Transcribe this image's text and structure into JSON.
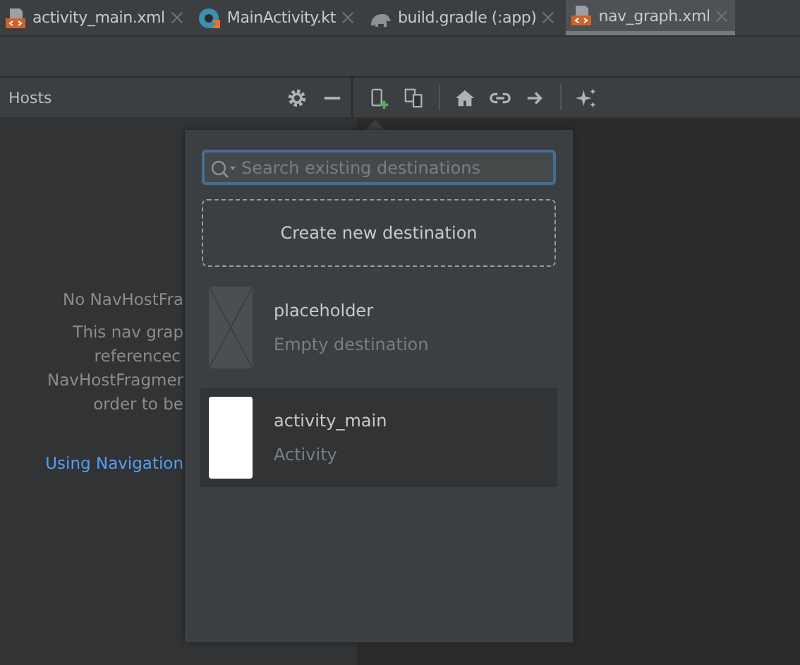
{
  "tabs": [
    {
      "label": "activity_main.xml",
      "kind": "xml",
      "selected": false
    },
    {
      "label": "MainActivity.kt",
      "kind": "kotlin",
      "selected": false
    },
    {
      "label": "build.gradle (:app)",
      "kind": "gradle",
      "selected": false
    },
    {
      "label": "nav_graph.xml",
      "kind": "xml",
      "selected": true
    }
  ],
  "hosts_panel": {
    "title": "Hosts",
    "lines": [
      "No NavHostFra",
      "This nav grap",
      "referencec",
      "NavHostFragmer",
      "order to be"
    ],
    "link": "Using Navigation"
  },
  "popup": {
    "search": {
      "placeholder": "Search existing destinations"
    },
    "create_button": "Create new destination",
    "destinations": [
      {
        "kind": "placeholder",
        "name": "placeholder",
        "type": "Empty destination",
        "selected": false
      },
      {
        "kind": "activity",
        "name": "activity_main",
        "type": "Activity",
        "selected": true
      }
    ]
  }
}
